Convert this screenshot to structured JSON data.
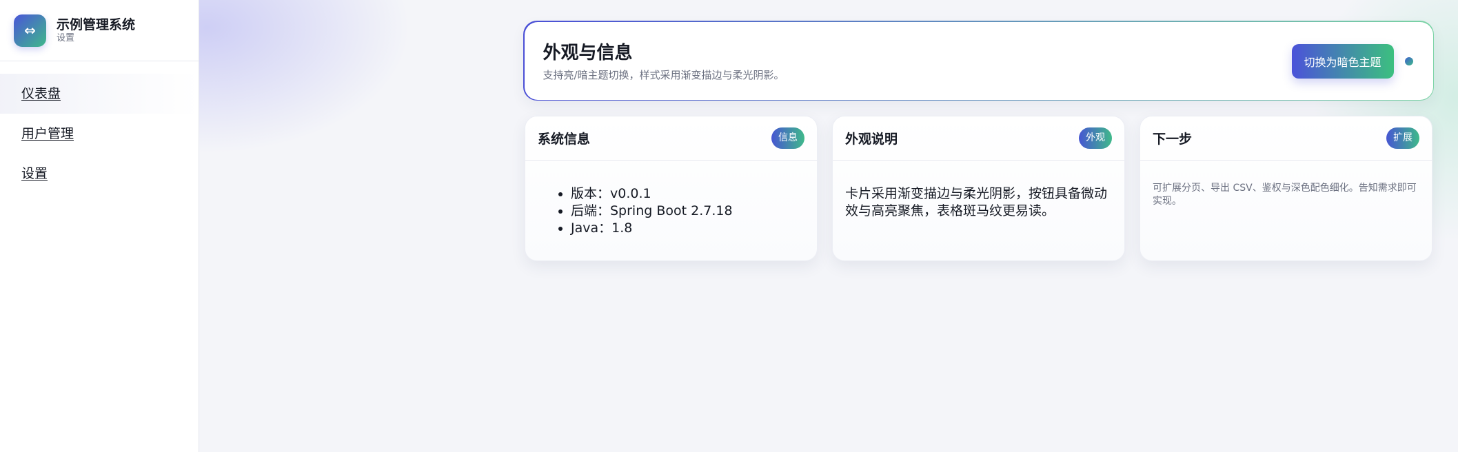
{
  "sidebar": {
    "brand_icon": "⇔",
    "brand_title": "示例管理系统",
    "brand_subtitle": "设置",
    "items": [
      {
        "label": "仪表盘"
      },
      {
        "label": "用户管理"
      },
      {
        "label": "设置"
      }
    ]
  },
  "hero": {
    "title": "外观与信息",
    "subtitle": "支持亮/暗主题切换，样式采用渐变描边与柔光阴影。",
    "theme_button": "切换为暗色主题"
  },
  "cards": {
    "system": {
      "title": "系统信息",
      "badge": "信息",
      "items": [
        "版本：v0.0.1",
        "后端：Spring Boot 2.7.18",
        "Java：1.8"
      ]
    },
    "appearance": {
      "title": "外观说明",
      "badge": "外观",
      "text": "卡片采用渐变描边与柔光阴影，按钮具备微动效与高亮聚焦，表格斑马纹更易读。"
    },
    "next": {
      "title": "下一步",
      "badge": "扩展",
      "text": "可扩展分页、导出 CSV、鉴权与深色配色细化。告知需求即可实现。"
    }
  },
  "colors": {
    "accent_start": "#4a4fd6",
    "accent_end": "#3cc07f",
    "text_primary": "#161a24",
    "text_secondary": "#6b7080"
  }
}
